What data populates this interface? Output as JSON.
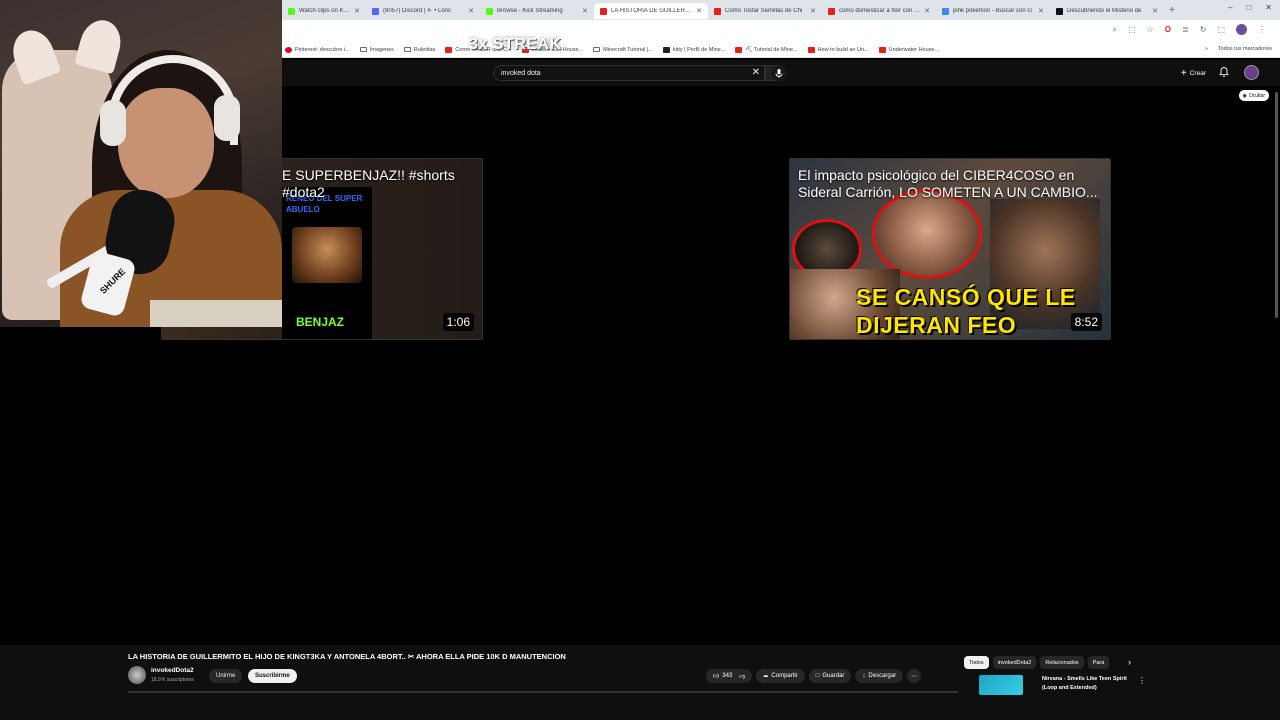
{
  "browser": {
    "tabs": [
      {
        "title": "Watch clips on Kick",
        "color": "#53fc18",
        "active": false
      },
      {
        "title": "(8057) Discord | #· • Lonc",
        "color": "#5865f2",
        "active": false
      },
      {
        "title": "Browse - Kick Streaming",
        "color": "#53fc18",
        "active": false
      },
      {
        "title": "LA HISTORIA DE GUILLERMITO",
        "color": "#e62117",
        "active": true
      },
      {
        "title": "Cómo Tostar Semillas de Chi",
        "color": "#e62117",
        "active": false
      },
      {
        "title": "como domesticar a Nor con pe",
        "color": "#e62117",
        "active": false
      },
      {
        "title": "pink pokemon - Buscar con G",
        "color": "#4285f4",
        "active": false
      },
      {
        "title": "Descubriendo el Misterio de",
        "color": "#111111",
        "active": false
      }
    ],
    "new_tab": "+",
    "window_controls": [
      "–",
      "□",
      "✕"
    ],
    "toolbar_icons": [
      "⌕",
      "⬚",
      "☆",
      "O",
      "≣",
      "↻",
      "⬚",
      "⋮"
    ],
    "bookmarks": [
      {
        "label": "Pinterest: descubre i...",
        "icon": "pin"
      },
      {
        "label": "Imagenes",
        "icon": "fold"
      },
      {
        "label": "Ruletitas",
        "icon": "fold"
      },
      {
        "label": "Como HACER una C...",
        "icon": "yt"
      },
      {
        "label": "Modern Cliff House...",
        "icon": "yt"
      },
      {
        "label": "Minecraft Tutorial |...",
        "icon": "fold"
      },
      {
        "label": "kitty | Perfil de Mine...",
        "icon": "dark"
      },
      {
        "label": "⛏ Tutorial de Mine...",
        "icon": "yt"
      },
      {
        "label": "How to build an Un...",
        "icon": "yt"
      },
      {
        "label": "Underwater House...",
        "icon": "yt"
      }
    ],
    "bookmarks_more": "»",
    "all_bookmarks": "Todos tus marcadores"
  },
  "youtube": {
    "search_value": "invoked dota",
    "clear": "✕",
    "create_label": "Crear",
    "hide_label": "Ocultar",
    "end_cards": [
      {
        "title": "E SUPERBENJAZ!! #shorts #dota2",
        "duration": "1:06",
        "thumb_header": "RENEO DEL SUPER ABUELO",
        "thumb_name": "BENJAZ"
      },
      {
        "title": "El impacto psicológico del CIBER4COSO en Sideral Carrión, LO SOMETEN A UN CAMBIO...",
        "duration": "8:52",
        "thumb_caption": "SE CANSÓ QUE LE DIJERAN FEO"
      }
    ],
    "video": {
      "title": "LA HISTORIA DE GUILLERMITO EL HIJO DE KINGT3KA Y ANTONELA 4BORT.. ✂ AHORA ELLA PIDE 10K D MANUTENCION",
      "channel": "invokedDota2",
      "subscribers": "18,9 K suscriptores",
      "join_label": "Unirme",
      "subscribe_label": "Suscribirme",
      "likes": "343",
      "share_label": "Compartir",
      "save_label": "Guardar",
      "download_label": "Descargar",
      "more": "⋯"
    },
    "chips": [
      {
        "label": "Todos",
        "selected": true
      },
      {
        "label": "invokedDota2",
        "selected": false
      },
      {
        "label": "Relacionados",
        "selected": false
      },
      {
        "label": "Para",
        "selected": false
      }
    ],
    "chips_next": "›",
    "recommendation": {
      "title": "Nirvana - Smells Like Teen Spirit (Loop and Extended)",
      "more": "⋮"
    }
  },
  "overlay": {
    "streak_text": "3x STREAK",
    "mic_brand": "SHURE"
  },
  "colors": {
    "yt_bg": "#0f0f0f",
    "accent_red": "#e62117",
    "caption_yellow": "#ffe600",
    "thumb_green": "#7cff2e"
  }
}
